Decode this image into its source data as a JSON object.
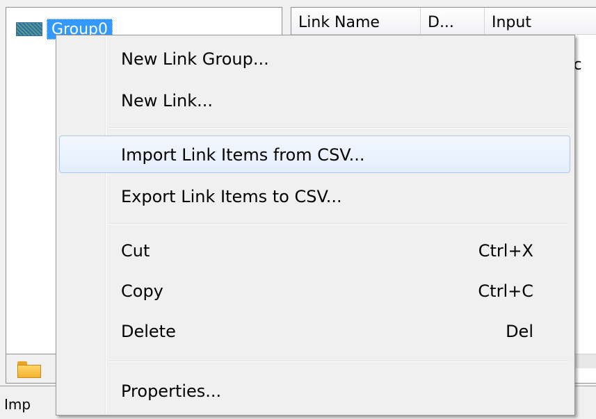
{
  "tree": {
    "group_label": "Group0"
  },
  "list": {
    "columns": [
      "Link Name",
      "D...",
      "Input"
    ],
    "cell_partial": "ac"
  },
  "status": {
    "text": "Imp"
  },
  "context_menu": {
    "items": [
      {
        "label": "New Link Group...",
        "shortcut": ""
      },
      {
        "label": "New Link...",
        "shortcut": ""
      },
      {
        "label": "Import Link Items from CSV...",
        "shortcut": "",
        "highlighted": true
      },
      {
        "label": "Export Link Items to CSV...",
        "shortcut": ""
      },
      {
        "label": "Cut",
        "shortcut": "Ctrl+X"
      },
      {
        "label": "Copy",
        "shortcut": "Ctrl+C"
      },
      {
        "label": "Delete",
        "shortcut": "Del"
      },
      {
        "label": "Properties...",
        "shortcut": ""
      }
    ]
  },
  "colors": {
    "selection": "#3399ff",
    "menu_highlight_border": "#a9c7eb",
    "menu_background": "#f0f0f0"
  }
}
